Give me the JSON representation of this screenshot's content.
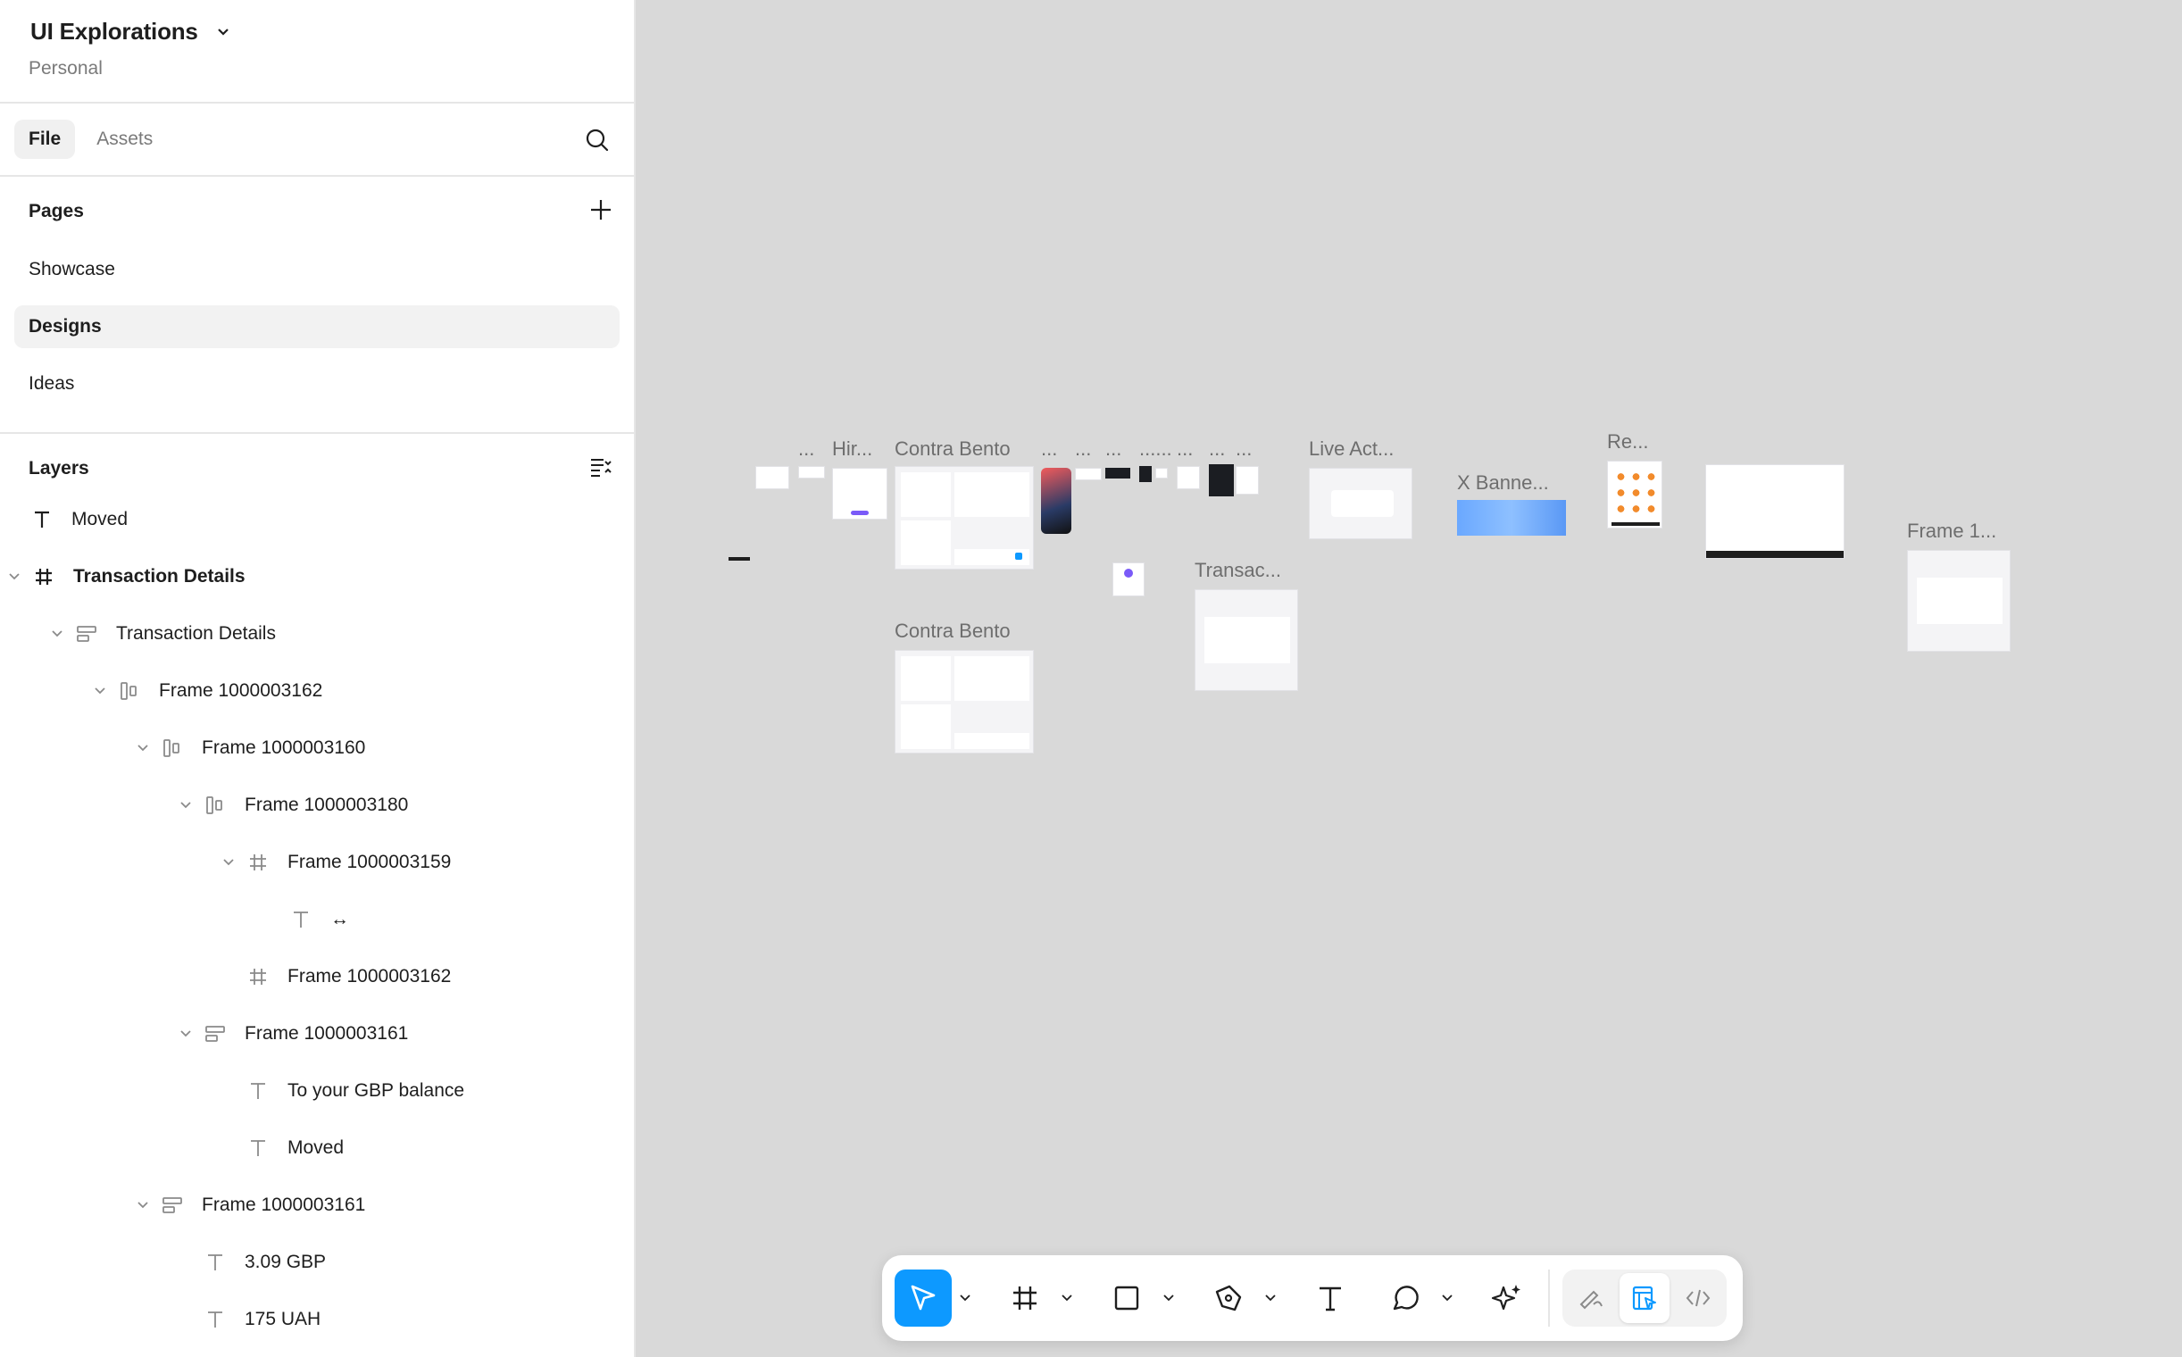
{
  "file": {
    "title": "UI Explorations",
    "subtitle": "Personal"
  },
  "tabs": [
    {
      "label": "File"
    },
    {
      "label": "Assets"
    }
  ],
  "pages": {
    "title": "Pages",
    "items": [
      {
        "label": "Showcase"
      },
      {
        "label": "Designs"
      },
      {
        "label": "Ideas"
      }
    ]
  },
  "layers": {
    "title": "Layers",
    "items": [
      {
        "label": "Moved"
      },
      {
        "label": "Transaction Details"
      },
      {
        "label": "Transaction Details"
      },
      {
        "label": "Frame 1000003162"
      },
      {
        "label": "Frame 1000003160"
      },
      {
        "label": "Frame 1000003180"
      },
      {
        "label": "Frame 1000003159"
      },
      {
        "label": "↔"
      },
      {
        "label": "Frame 1000003162"
      },
      {
        "label": "Frame 1000003161"
      },
      {
        "label": "To your GBP balance"
      },
      {
        "label": "Moved"
      },
      {
        "label": "Frame 1000003161"
      },
      {
        "label": "3.09 GBP"
      },
      {
        "label": "175 UAH"
      }
    ]
  },
  "canvas": {
    "labels": {
      "dots1": "...",
      "hir": "Hir...",
      "contra1": "Contra Bento",
      "dots2": "...",
      "dots3": "...",
      "dots4": "...",
      "dots5": "......",
      "dots6": "...",
      "dots7": "...",
      "dots8": "...",
      "live": "Live Act...",
      "xbanner": "X Banne...",
      "re": "Re...",
      "frame1": "Frame 1...",
      "transac": "Transac...",
      "contra2": "Contra Bento"
    }
  },
  "toolbar": {
    "tools": [
      "move-icon",
      "frame-icon",
      "rectangle-icon",
      "pen-icon",
      "text-icon",
      "comment-icon",
      "ai-sparkle-icon"
    ],
    "modes": [
      "draw-mode-icon",
      "design-mode-icon",
      "dev-mode-icon"
    ],
    "accent": "#0d99ff"
  }
}
